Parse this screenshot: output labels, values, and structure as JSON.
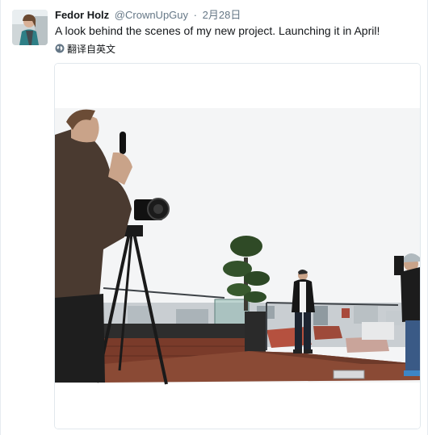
{
  "tweet": {
    "author_name": "Fedor Holz",
    "author_handle": "@CrownUpGuy",
    "separator": "·",
    "date": "2月28日",
    "text": "A look behind the scenes of my new project. Launching it in April!",
    "translate_label": "翻译自英文"
  },
  "icons": {
    "translate": "globe-icon"
  },
  "colors": {
    "name": "#14171a",
    "secondary": "#657786",
    "border": "#e1e8ed"
  }
}
